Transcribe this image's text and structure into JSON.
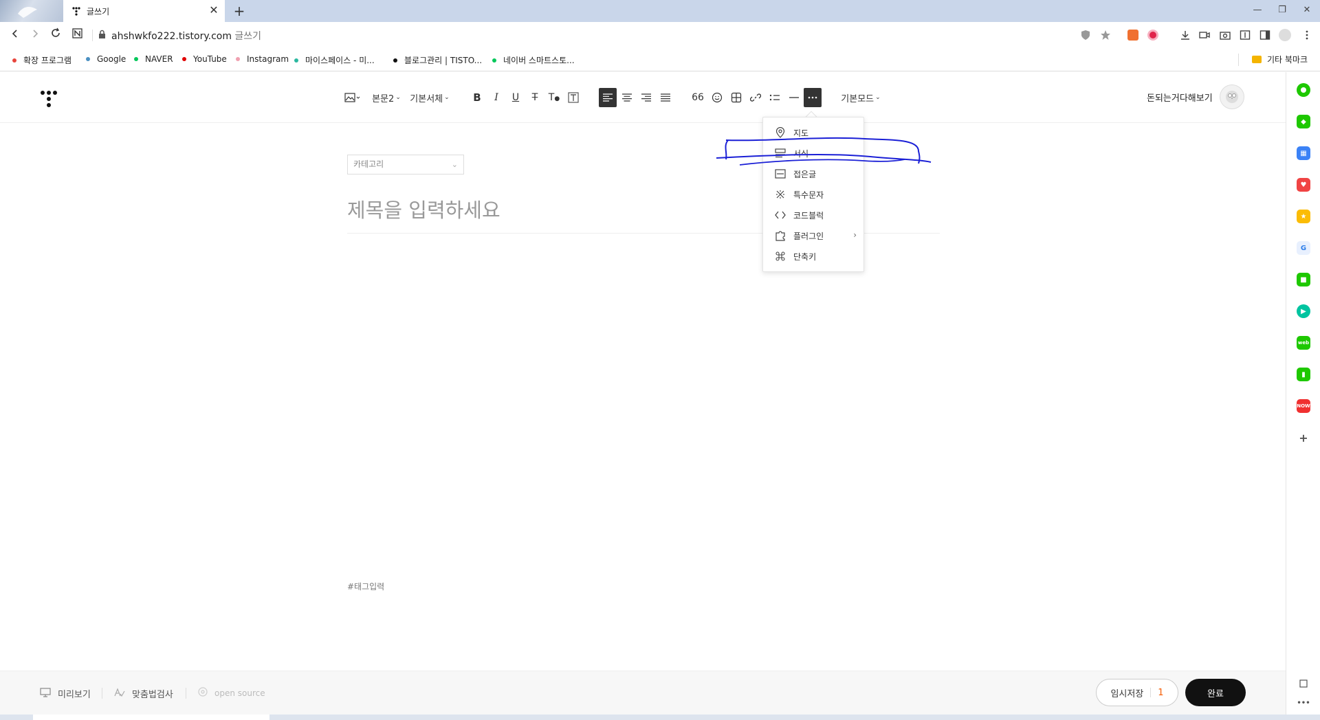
{
  "browser": {
    "tab_title": "글쓰기",
    "close_symbol": "✕",
    "newtab_symbol": "+",
    "url_domain": "ahshwkfo222.tistory.com",
    "url_path": "글쓰기",
    "window_controls": [
      "—",
      "❐",
      "✕"
    ]
  },
  "bookmarks": [
    {
      "label": "확장 프로그램",
      "color": "#e8453c"
    },
    {
      "label": "Google",
      "color": "#4a90c2"
    },
    {
      "label": "NAVER",
      "color": "#03c75a"
    },
    {
      "label": "YouTube",
      "color": "#e00000"
    },
    {
      "label": "Instagram",
      "color": "#f0a0b0"
    },
    {
      "label": "마이스페이스 - 미...",
      "color": "#2bb8a0"
    },
    {
      "label": "블로그관리 | TISTO...",
      "color": "#111111"
    },
    {
      "label": "네이버 스마트스토...",
      "color": "#03c75a"
    }
  ],
  "bookmarks_other": "기타 북마크",
  "editor": {
    "toolbar": {
      "paragraph_style": "본문2",
      "font": "기본서체",
      "mode": "기본모드",
      "quote_label": "66"
    },
    "blog_name": "돈되는거다해보기",
    "category_placeholder": "카테고리",
    "title_placeholder": "제목을 입력하세요",
    "tag_placeholder": "#태그입력"
  },
  "more_menu": {
    "items": [
      {
        "label": "지도",
        "icon": "map-pin-icon"
      },
      {
        "label": "서식",
        "icon": "template-icon"
      },
      {
        "label": "접은글",
        "icon": "fold-icon"
      },
      {
        "label": "특수문자",
        "icon": "special-char-icon"
      },
      {
        "label": "코드블럭",
        "icon": "code-icon"
      },
      {
        "label": "플러그인",
        "icon": "plugin-icon"
      },
      {
        "label": "단축키",
        "icon": "shortcut-icon"
      }
    ]
  },
  "footer": {
    "preview": "미리보기",
    "spellcheck": "맞춤법검사",
    "opensource": "open source",
    "save_label": "임시저장",
    "save_count": "1",
    "done_label": "완료"
  },
  "colors": {
    "annotation_pen": "#1a1fd6",
    "accent_orange": "#f55b00"
  }
}
